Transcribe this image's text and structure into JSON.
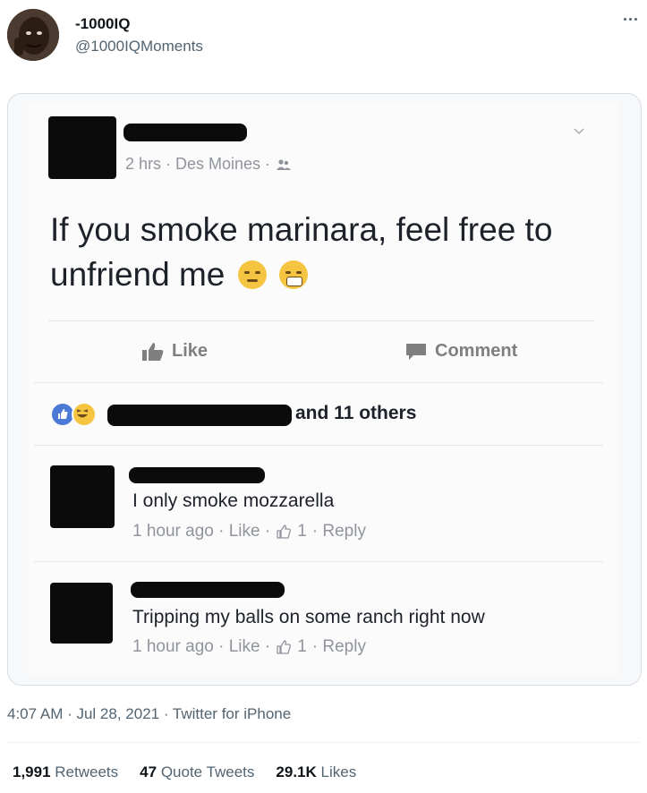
{
  "tweet": {
    "author_name": "-1000IQ",
    "author_handle": "@1000IQMoments",
    "timestamp": "4:07 AM · Jul 28, 2021 · Twitter for iPhone",
    "stats": {
      "retweets_count": "1,991",
      "retweets_label": "Retweets",
      "quotes_count": "47",
      "quotes_label": "Quote Tweets",
      "likes_count": "29.1K",
      "likes_label": "Likes"
    }
  },
  "fb_post": {
    "meta": "2 hrs · Des Moines ·",
    "text": "If you smoke marinara, feel free to unfriend me",
    "like_label": "Like",
    "comment_label": "Comment",
    "reactions_text": "and 11 others",
    "comments": [
      {
        "text": "I only smoke mozzarella",
        "meta": "1 hour ago · Like ·",
        "likes": "1",
        "reply": "· Reply"
      },
      {
        "text": "Tripping my balls on some ranch right now",
        "meta": "1 hour ago · Like ·",
        "likes": "1",
        "reply": "· Reply"
      }
    ]
  },
  "colors": {
    "twitter_text": "#0f1419",
    "twitter_secondary": "#536471",
    "fb_gray": "#90949c",
    "fb_like_blue": "#4b7ad6",
    "redaction": "#0b0b0b"
  },
  "icons": [
    "more-icon",
    "chevron-down-icon",
    "friends-icon",
    "like-icon",
    "comment-icon",
    "thumbs-up-icon",
    "haha-reaction-icon"
  ]
}
